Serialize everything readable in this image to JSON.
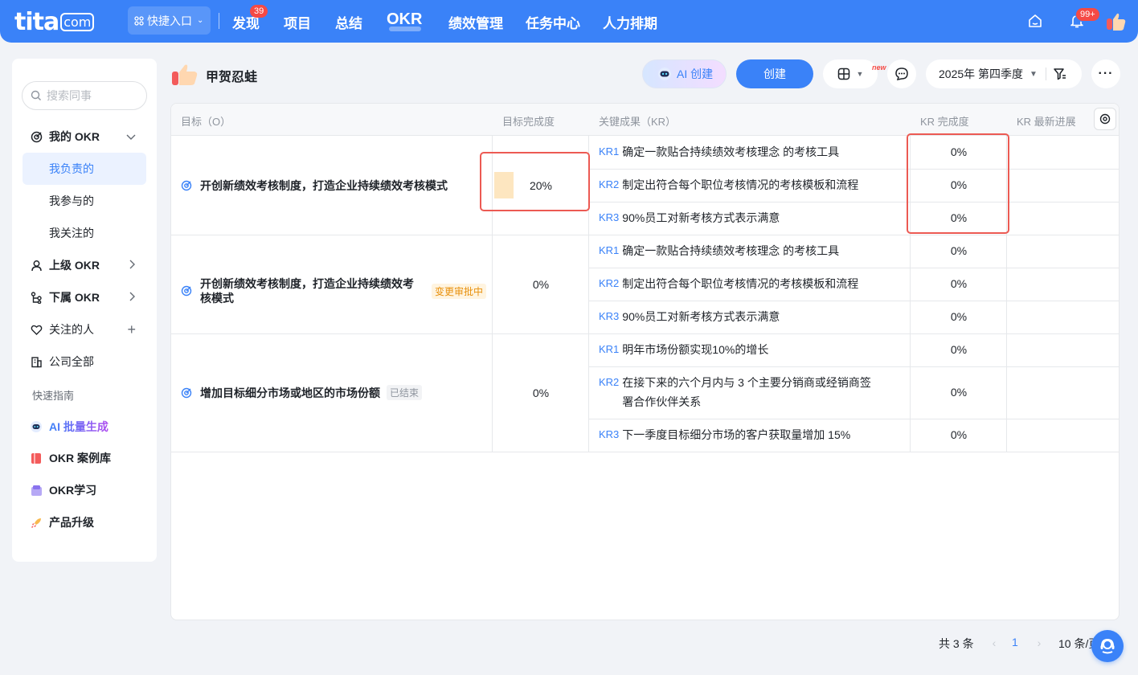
{
  "topbar": {
    "logo": "tita",
    "logo_suffix": "com",
    "quick_entry": "快捷入口",
    "nav": [
      {
        "label": "发现",
        "badge": "39"
      },
      {
        "label": "项目"
      },
      {
        "label": "总结"
      },
      {
        "label": "OKR",
        "active": true
      },
      {
        "label": "绩效管理"
      },
      {
        "label": "任务中心"
      },
      {
        "label": "人力排期"
      }
    ],
    "bell_badge": "99+",
    "icons": [
      "home-icon",
      "bell-icon",
      "avatar"
    ]
  },
  "sidebar": {
    "search_placeholder": "搜索同事",
    "my_okr": "我的 OKR",
    "sub_items": [
      "我负责的",
      "我参与的",
      "我关注的"
    ],
    "superior_okr": "上级 OKR",
    "subordinate_okr": "下属 OKR",
    "followed": "关注的人",
    "company_all": "公司全部",
    "quick_guide": "快速指南",
    "ai_batch": "AI 批量生成",
    "case_lib": "OKR 案例库",
    "okr_learn": "OKR学习",
    "product_upgrade": "产品升级"
  },
  "header": {
    "title": "甲贺忍蛙",
    "ai_create": "AI 创建",
    "create": "创建",
    "new_tag": "new",
    "period": "2025年 第四季度"
  },
  "table": {
    "columns": [
      "目标（O）",
      "目标完成度",
      "关键成果（KR）",
      "KR 完成度",
      "KR 最新进展"
    ],
    "objectives": [
      {
        "title": "开创新绩效考核制度，打造企业持续绩效考核模式",
        "progress": "20%",
        "progress_value": 0.2,
        "tag": "",
        "krs": [
          {
            "no": "KR1",
            "text": "确定一款贴合持续绩效考核理念 的考核工具",
            "pct": "0%"
          },
          {
            "no": "KR2",
            "text": "制定出符合每个职位考核情况的考核模板和流程",
            "pct": "0%"
          },
          {
            "no": "KR3",
            "text": "90%员工对新考核方式表示满意",
            "pct": "0%"
          }
        ]
      },
      {
        "title": "开创新绩效考核制度，打造企业持续绩效考核模式",
        "progress": "0%",
        "tag": "变更审批中",
        "krs": [
          {
            "no": "KR1",
            "text": "确定一款贴合持续绩效考核理念 的考核工具",
            "pct": "0%"
          },
          {
            "no": "KR2",
            "text": "制定出符合每个职位考核情况的考核模板和流程",
            "pct": "0%"
          },
          {
            "no": "KR3",
            "text": "90%员工对新考核方式表示满意",
            "pct": "0%"
          }
        ]
      },
      {
        "title": "增加目标细分市场或地区的市场份额",
        "progress": "0%",
        "tag": "已结束",
        "krs": [
          {
            "no": "KR1",
            "text": "明年市场份额实现10%的增长",
            "pct": "0%"
          },
          {
            "no": "KR2",
            "text": "在接下来的六个月内与 3 个主要分销商或经销商签署合作伙伴关系",
            "pct": "0%"
          },
          {
            "no": "KR3",
            "text": "下一季度目标细分市场的客户获取量增加 15%",
            "pct": "0%"
          }
        ]
      }
    ]
  },
  "pager": {
    "total": "共 3 条",
    "page": "1",
    "size": "10 条/页"
  },
  "colors": {
    "primary": "#3a82f8",
    "highlight": "#ec5a53",
    "warn": "#e8900c",
    "progress_fill": "#fde6c0"
  }
}
